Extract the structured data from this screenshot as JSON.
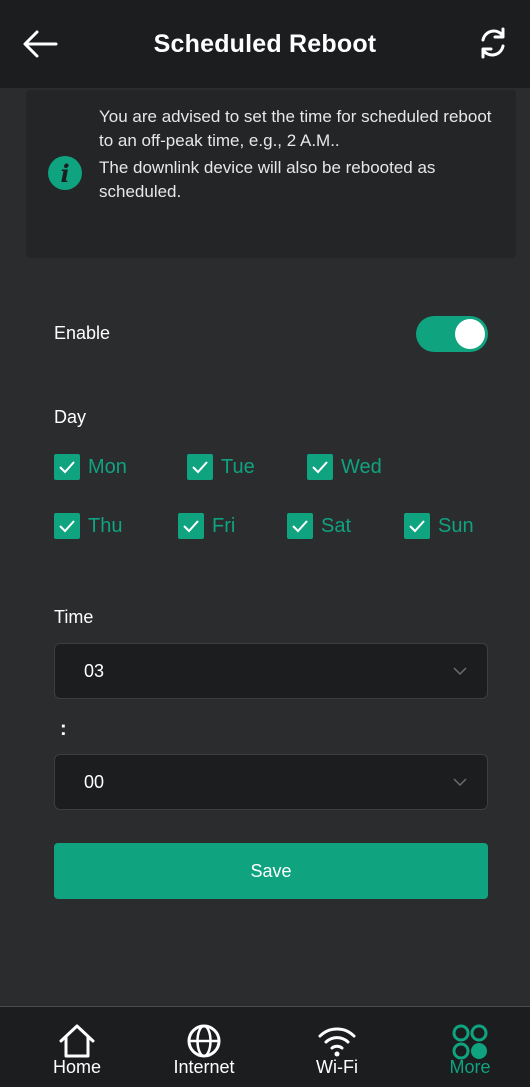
{
  "header": {
    "title": "Scheduled Reboot",
    "back_icon": "arrow-left-icon",
    "refresh_icon": "refresh-icon"
  },
  "notice": {
    "icon": "info-icon",
    "line1": "You are advised to set the time for scheduled reboot to an off-peak time, e.g., 2 A.M..",
    "line2": "The downlink device will also be rebooted as scheduled."
  },
  "enable": {
    "label": "Enable",
    "on": true
  },
  "day": {
    "label": "Day",
    "days": [
      {
        "label": "Mon",
        "checked": true
      },
      {
        "label": "Tue",
        "checked": true
      },
      {
        "label": "Wed",
        "checked": true
      },
      {
        "label": "Thu",
        "checked": true
      },
      {
        "label": "Fri",
        "checked": true
      },
      {
        "label": "Sat",
        "checked": true
      },
      {
        "label": "Sun",
        "checked": true
      }
    ]
  },
  "time": {
    "label": "Time",
    "hour": "03",
    "separator": ":",
    "minute": "00"
  },
  "save_label": "Save",
  "tabbar": {
    "items": [
      {
        "label": "Home",
        "icon": "home-icon",
        "active": false
      },
      {
        "label": "Internet",
        "icon": "globe-icon",
        "active": false
      },
      {
        "label": "Wi-Fi",
        "icon": "wifi-icon",
        "active": false
      },
      {
        "label": "More",
        "icon": "more-icon",
        "active": true
      }
    ]
  },
  "colors": {
    "accent": "#0fa380",
    "background": "#2b2c2e",
    "header": "#1b1d1f"
  }
}
